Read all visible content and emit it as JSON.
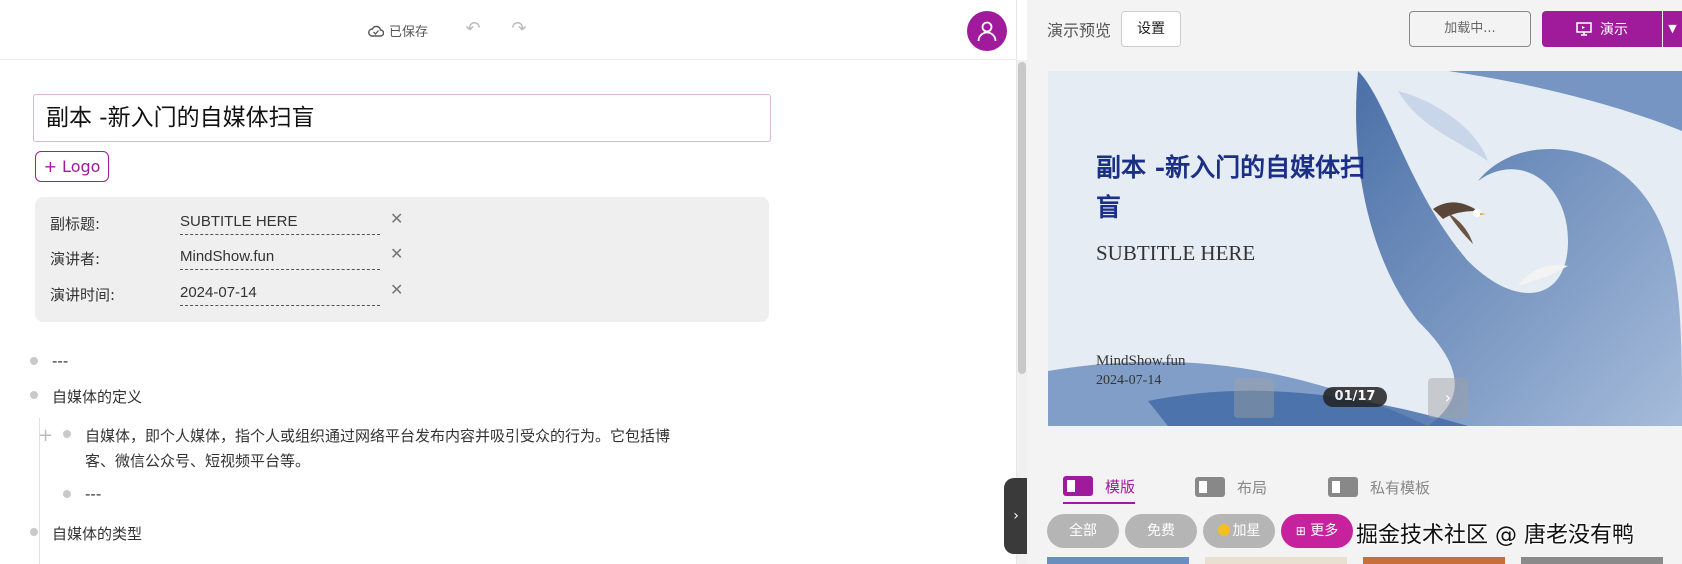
{
  "toolbar": {
    "saved_label": "已保存"
  },
  "editor": {
    "title": "副本 -新入门的自媒体扫盲",
    "logo_button": "+ Logo",
    "meta": [
      {
        "label": "副标题:",
        "value": "SUBTITLE HERE"
      },
      {
        "label": "演讲者:",
        "value": "MindShow.fun"
      },
      {
        "label": "演讲时间:",
        "value": "2024-07-14"
      }
    ],
    "lines": [
      "---",
      "自媒体的定义",
      "自媒体，即个人媒体，指个人或组织通过网络平台发布内容并吸引受众的行为。它包括博",
      "客、微信公众号、短视频平台等。",
      "---",
      "自媒体的类型"
    ]
  },
  "preview": {
    "label": "演示预览",
    "settings_button": "设置",
    "loading_button": "加载中...",
    "present_button": "演示",
    "slide": {
      "title": "副本 -新入门的自媒体扫盲",
      "subtitle": "SUBTITLE HERE",
      "author": "MindShow.fun",
      "date": "2024-07-14",
      "counter": "01/17"
    },
    "tabs": [
      "模版",
      "布局",
      "私有模板"
    ],
    "filters": [
      "全部",
      "免费",
      "加星",
      "更多"
    ]
  },
  "colors": {
    "accent": "#a01b9c",
    "slide_title": "#1b2f86"
  },
  "watermark": "掘金技术社区 @ 唐老没有鸭"
}
